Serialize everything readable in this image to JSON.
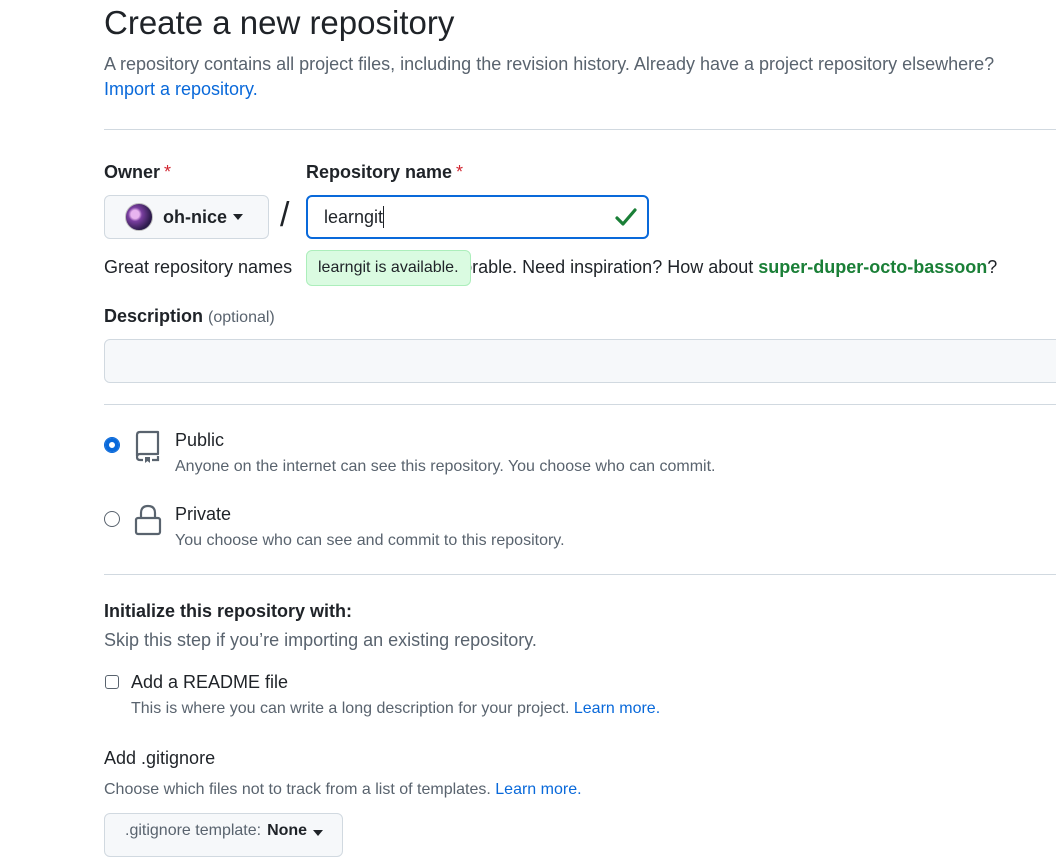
{
  "header": {
    "title": "Create a new repository",
    "subtitle": "A repository contains all project files, including the revision history. Already have a project repository elsewhere?",
    "import_link": "Import a repository."
  },
  "owner": {
    "label": "Owner",
    "required_mark": "*",
    "value": "oh-nice"
  },
  "separator": "/",
  "repo_name": {
    "label": "Repository name",
    "required_mark": "*",
    "value": "learngit",
    "availability_tooltip": "learngit is available."
  },
  "hint": {
    "prefix": "Great repository names",
    "suffix": "orable. Need inspiration? How about",
    "suggestion": "super-duper-octo-bassoon",
    "end": "?"
  },
  "description": {
    "label": "Description",
    "optional": "(optional)",
    "value": ""
  },
  "visibility": {
    "public": {
      "title": "Public",
      "desc": "Anyone on the internet can see this repository. You choose who can commit.",
      "selected": true
    },
    "private": {
      "title": "Private",
      "desc": "You choose who can see and commit to this repository.",
      "selected": false
    }
  },
  "init": {
    "title": "Initialize this repository with:",
    "desc": "Skip this step if you’re importing an existing repository.",
    "readme_label": "Add a README file",
    "readme_desc": "This is where you can write a long description for your project.",
    "readme_link": "Learn more.",
    "readme_checked": false
  },
  "gitignore": {
    "title": "Add .gitignore",
    "desc": "Choose which files not to track from a list of templates.",
    "link": "Learn more.",
    "button_label": ".gitignore template:",
    "button_value": "None"
  },
  "colors": {
    "accent": "#0969da",
    "success": "#1a7f37",
    "danger": "#d1242f"
  }
}
